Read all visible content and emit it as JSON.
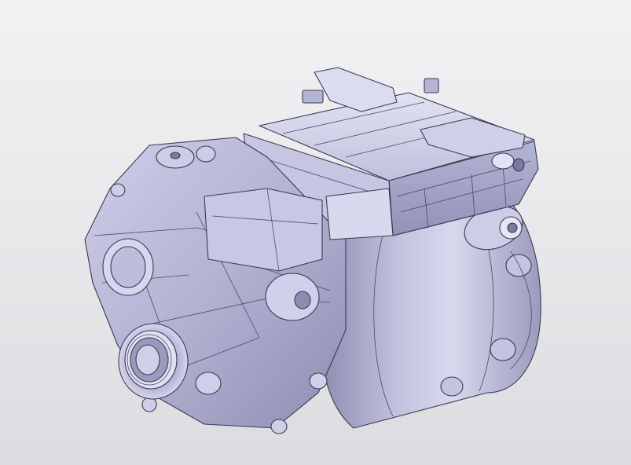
{
  "viewport": {
    "background": "#e8e8ea"
  },
  "model": {
    "colors": {
      "base": "#b6b6d6",
      "light": "#d4d4ec",
      "highlight": "#e6e6f6",
      "shadow": "#8c8cb0",
      "dark": "#6e6e92",
      "edge": "#3a3a52"
    },
    "parts": [
      "motor-housing",
      "gearbox-housing",
      "inverter-housing",
      "inverter-cover",
      "output-shaft-bore",
      "mount-boss"
    ]
  }
}
